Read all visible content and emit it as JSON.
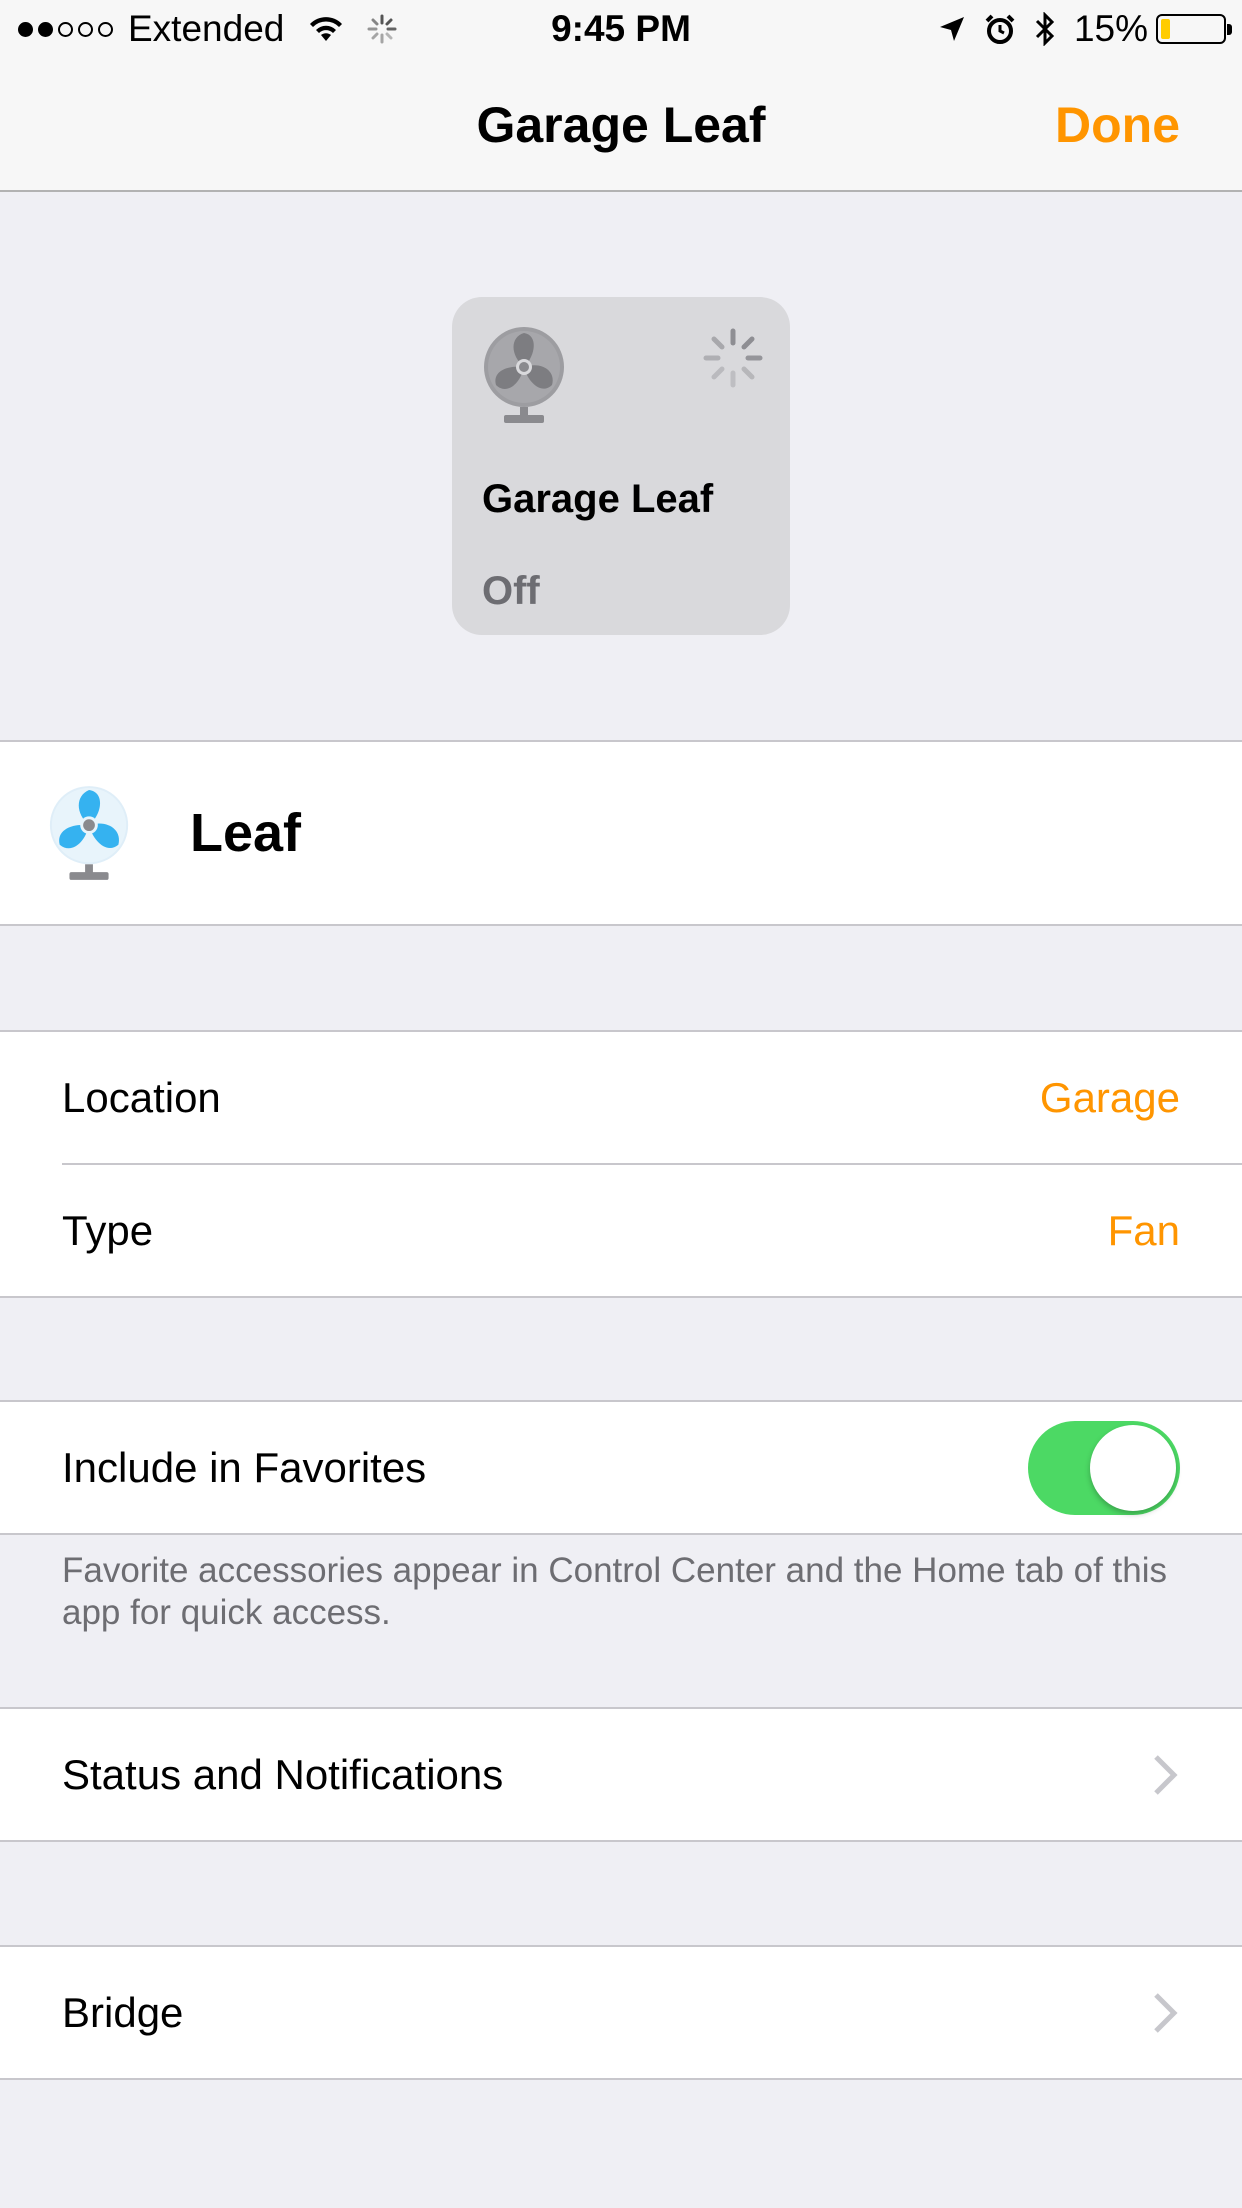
{
  "status_bar": {
    "signal": "●●○○○",
    "carrier": "Extended",
    "time": "9:45 PM",
    "battery_percent": "15%",
    "battery_level": 0.15,
    "icons": [
      "wifi-icon",
      "activity-spinner-icon",
      "location-arrow-icon",
      "alarm-icon",
      "bluetooth-icon",
      "battery-icon"
    ]
  },
  "nav": {
    "title": "Garage Leaf",
    "done_label": "Done"
  },
  "tile": {
    "name": "Garage Leaf",
    "status": "Off",
    "icon": "fan-icon",
    "spinner": "loading-spinner-icon"
  },
  "accessory": {
    "name": "Leaf",
    "icon": "fan-icon",
    "icon_color": "#35b2f0"
  },
  "details": {
    "location_label": "Location",
    "location_value": "Garage",
    "type_label": "Type",
    "type_value": "Fan"
  },
  "favorites": {
    "label": "Include in Favorites",
    "enabled": true,
    "note": "Favorite accessories appear in Control Center and the Home tab of this app for quick access."
  },
  "status_notifications": {
    "label": "Status and Notifications"
  },
  "bridge": {
    "label": "Bridge"
  },
  "colors": {
    "accent": "#ff9500",
    "toggle_on": "#4cd964",
    "background": "#efeff4"
  }
}
